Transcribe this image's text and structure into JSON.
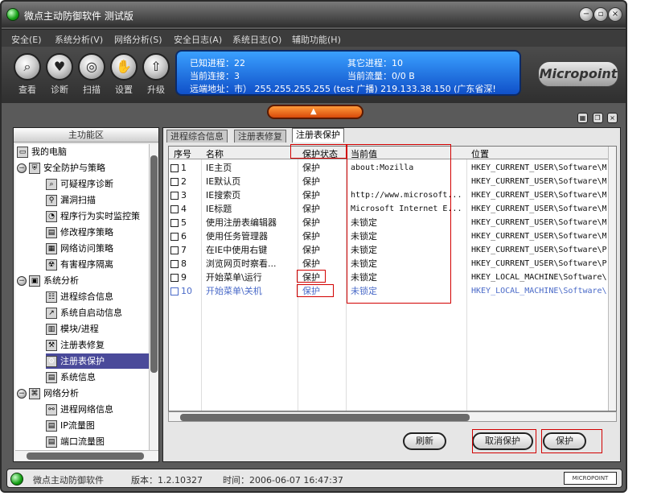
{
  "title_bar": {
    "title": "微点主动防御软件   测试版"
  },
  "menu": [
    "安全(E)",
    "系统分析(V)",
    "网络分析(S)",
    "安全日志(A)",
    "系统日志(O)",
    "辅助功能(H)"
  ],
  "toolbar": {
    "buttons": [
      {
        "label": "查看",
        "icon": "magnifier-icon"
      },
      {
        "label": "诊断",
        "icon": "heart-icon"
      },
      {
        "label": "扫描",
        "icon": "scan-icon"
      },
      {
        "label": "设置",
        "icon": "hand-icon"
      },
      {
        "label": "升级",
        "icon": "upgrade-icon"
      }
    ]
  },
  "info": {
    "line1_left": "已知进程：22",
    "line1_right": "其它进程：10",
    "line2_left": "当前连接：3",
    "line2_right": "当前流量：0/0 B",
    "line3": "远端地址：市）  255.255.255.255 (test 广播)   219.133.38.150 (广东省深!"
  },
  "logo": {
    "text": "Micropoint"
  },
  "left_panel": {
    "header": "主功能区",
    "tree": [
      {
        "label": "我的电脑",
        "icon": "computer-icon",
        "level": 0
      },
      {
        "label": "安全防护与策略",
        "icon": "shield-icon",
        "level": 1,
        "expander": "−"
      },
      {
        "label": "可疑程序诊断",
        "icon": "magnifier-icon",
        "level": 2
      },
      {
        "label": "漏洞扫描",
        "icon": "search-icon",
        "level": 2
      },
      {
        "label": "程序行为实时监控策",
        "icon": "monitor-icon",
        "level": 2
      },
      {
        "label": "修改程序策略",
        "icon": "document-icon",
        "level": 2
      },
      {
        "label": "网络访问策略",
        "icon": "network-icon",
        "level": 2
      },
      {
        "label": "有害程序隔离",
        "icon": "quarantine-icon",
        "level": 2
      },
      {
        "label": "系统分析",
        "icon": "system-icon",
        "level": 1,
        "expander": "−"
      },
      {
        "label": "进程综合信息",
        "icon": "process-icon",
        "level": 2
      },
      {
        "label": "系统自启动信息",
        "icon": "startup-icon",
        "level": 2
      },
      {
        "label": "模块/进程",
        "icon": "module-icon",
        "level": 2
      },
      {
        "label": "注册表修复",
        "icon": "registry-repair-icon",
        "level": 2
      },
      {
        "label": "注册表保护",
        "icon": "registry-protect-icon",
        "level": 2,
        "selected": true
      },
      {
        "label": "系统信息",
        "icon": "info-icon",
        "level": 2
      },
      {
        "label": "网络分析",
        "icon": "network-analysis-icon",
        "level": 1,
        "expander": "−"
      },
      {
        "label": "进程网络信息",
        "icon": "process-network-icon",
        "level": 2
      },
      {
        "label": "IP流量图",
        "icon": "ip-chart-icon",
        "level": 2
      },
      {
        "label": "端口流量图",
        "icon": "port-chart-icon",
        "level": 2
      }
    ]
  },
  "tabs": [
    {
      "label": "进程综合信息",
      "active": false
    },
    {
      "label": "注册表修复",
      "active": false
    },
    {
      "label": "注册表保护",
      "active": true
    }
  ],
  "table": {
    "columns": [
      "序号",
      "名称",
      "保护状态",
      "当前值",
      "位置"
    ],
    "rows": [
      {
        "no": "1",
        "name": "IE主页",
        "status": "保护",
        "value": "about:Mozilla",
        "location": "HKEY_CURRENT_USER\\Software\\M"
      },
      {
        "no": "2",
        "name": "IE默认页",
        "status": "保护",
        "value": "",
        "location": "HKEY_CURRENT_USER\\Software\\M"
      },
      {
        "no": "3",
        "name": "IE搜索页",
        "status": "保护",
        "value": "http://www.microsoft...",
        "location": "HKEY_CURRENT_USER\\Software\\M"
      },
      {
        "no": "4",
        "name": "IE标题",
        "status": "保护",
        "value": "Microsoft Internet E...",
        "location": "HKEY_CURRENT_USER\\Software\\M"
      },
      {
        "no": "5",
        "name": "使用注册表编辑器",
        "status": "保护",
        "value": "未锁定",
        "location": "HKEY_CURRENT_USER\\Software\\M"
      },
      {
        "no": "6",
        "name": "使用任务管理器",
        "status": "保护",
        "value": "未锁定",
        "location": "HKEY_CURRENT_USER\\Software\\M"
      },
      {
        "no": "7",
        "name": "在IE中使用右键",
        "status": "保护",
        "value": "未锁定",
        "location": "HKEY_CURRENT_USER\\Software\\P"
      },
      {
        "no": "8",
        "name": "浏览网页时察看...",
        "status": "保护",
        "value": "未锁定",
        "location": "HKEY_CURRENT_USER\\Software\\P"
      },
      {
        "no": "9",
        "name": "开始菜单\\运行",
        "status": "保护",
        "value": "未锁定",
        "location": "HKEY_LOCAL_MACHINE\\Software\\"
      },
      {
        "no": "10",
        "name": "开始菜单\\关机",
        "status": "保护",
        "value": "未锁定",
        "location": "HKEY_LOCAL_MACHINE\\Software\\"
      }
    ]
  },
  "buttons": {
    "refresh": "刷新",
    "unprotect": "取消保护",
    "protect": "保护"
  },
  "status_bar": {
    "app": "微点主动防御软件",
    "version": "版本：1.2.10327",
    "time": "时间：2006-06-07  16:47:37",
    "badge": "MICROPOINT"
  },
  "colors": {
    "highlight_box": "#d20000",
    "selected_tree": "#4a4a9a",
    "info_panel": "#1f6fe0",
    "disabled_row": "#4a6ac8"
  }
}
